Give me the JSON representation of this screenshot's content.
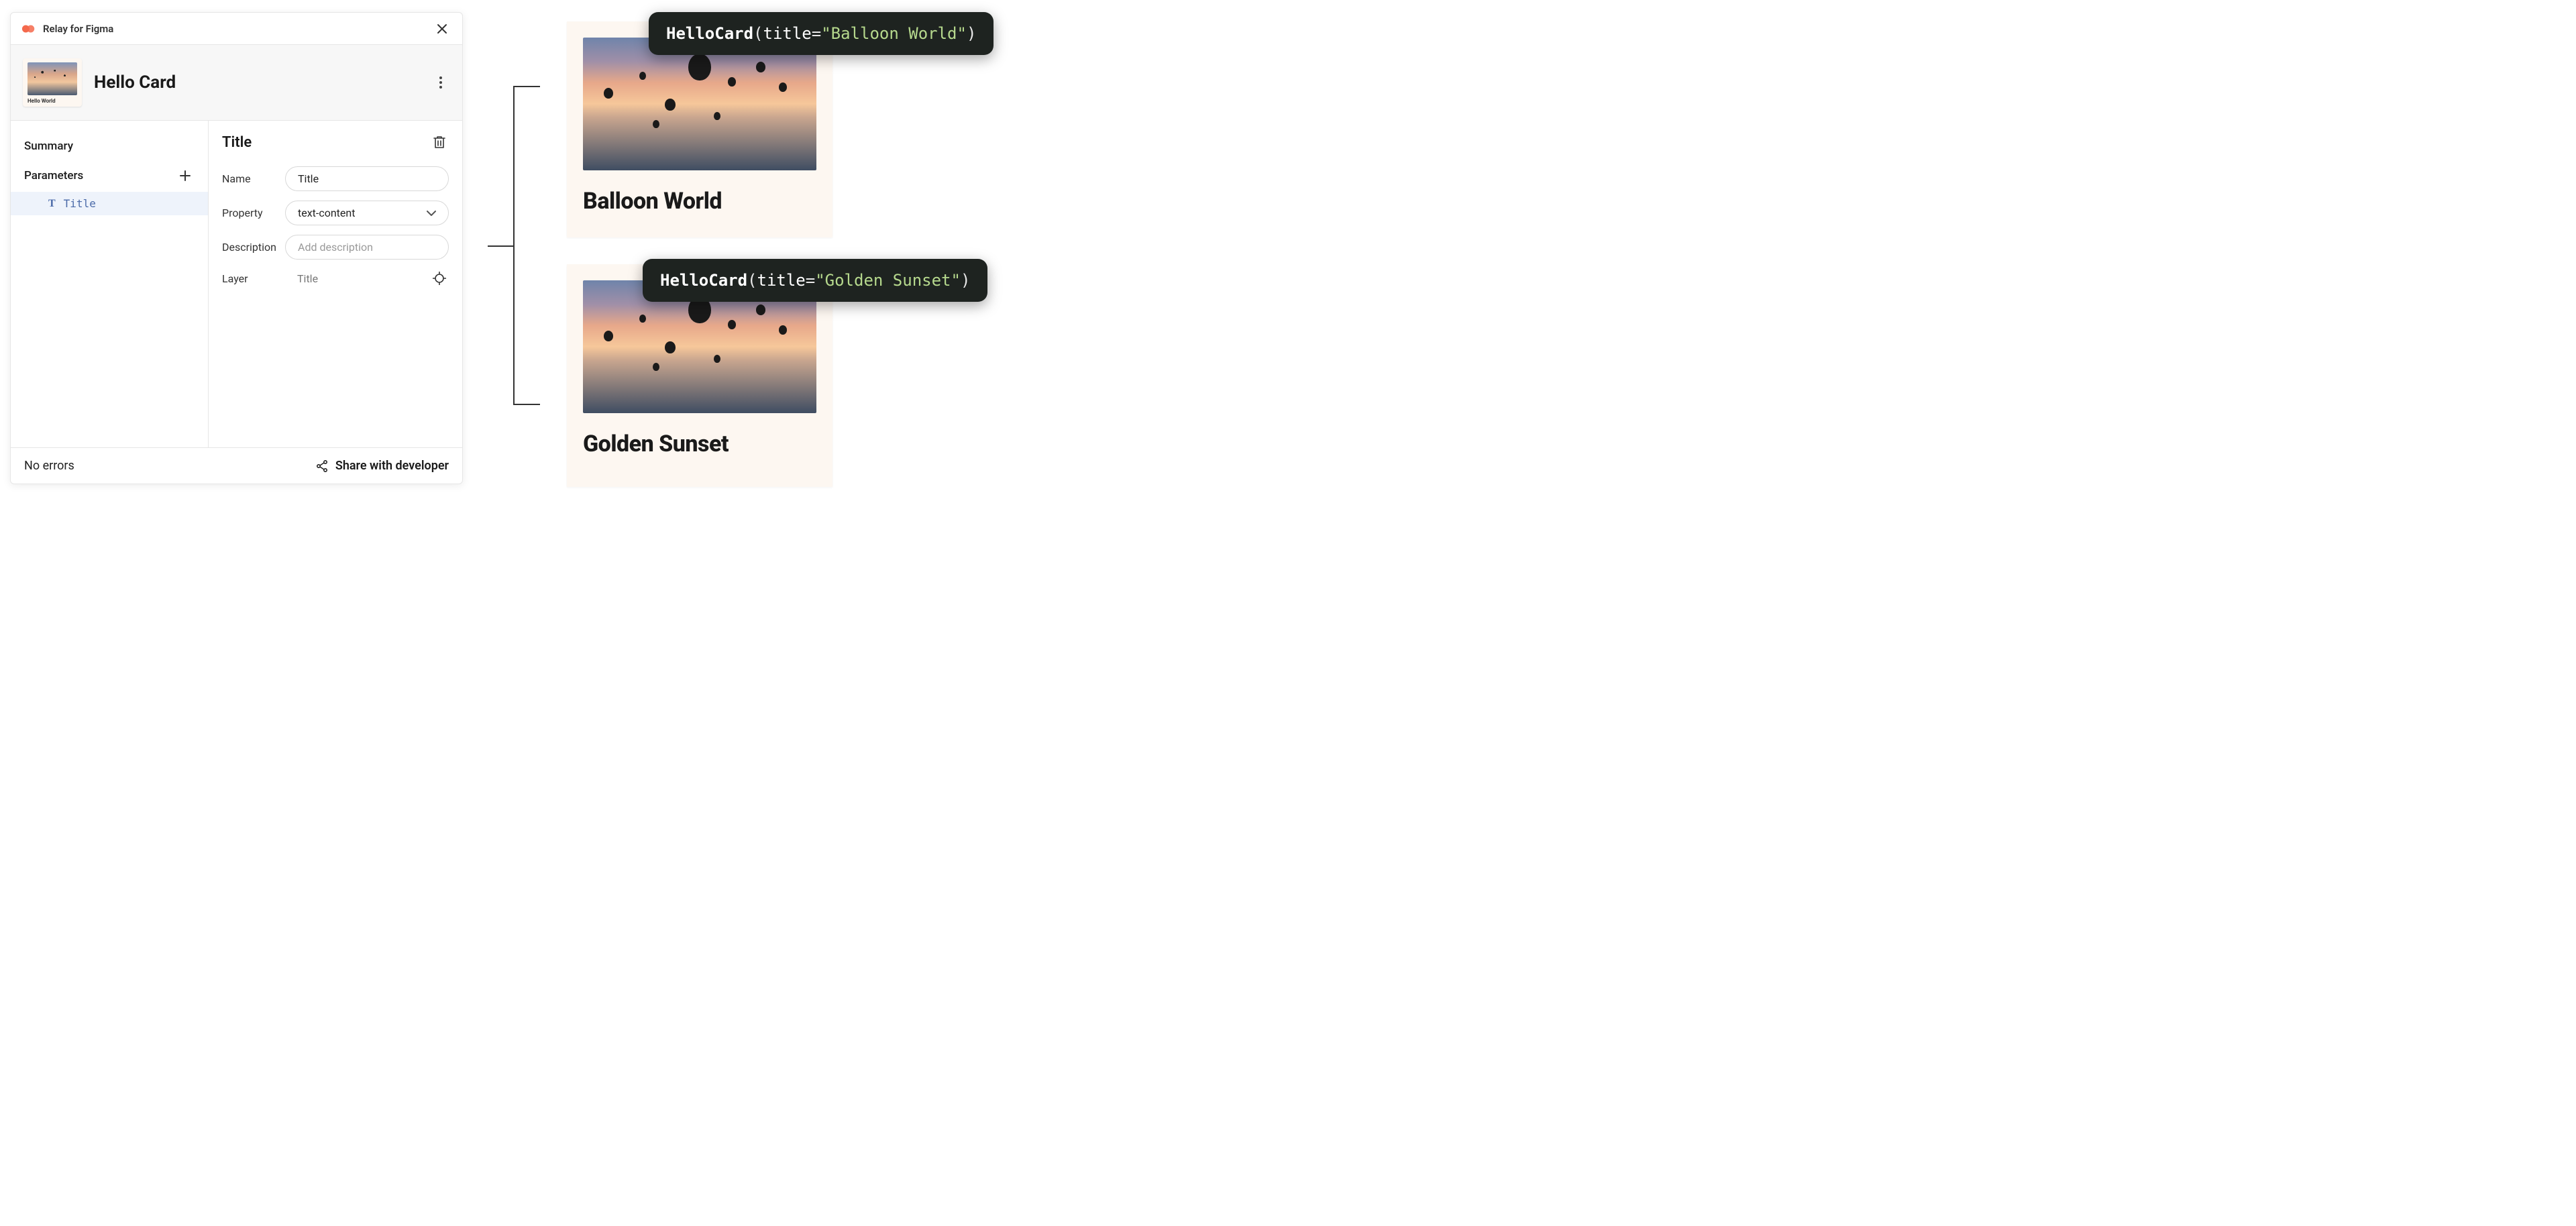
{
  "plugin": {
    "title": "Relay for Figma",
    "component_name": "Hello Card",
    "thumb_caption": "Hello World"
  },
  "sidebar": {
    "summary_label": "Summary",
    "parameters_label": "Parameters",
    "items": [
      {
        "label": "Title"
      }
    ]
  },
  "detail": {
    "heading": "Title",
    "fields": {
      "name_label": "Name",
      "name_value": "Title",
      "property_label": "Property",
      "property_value": "text-content",
      "description_label": "Description",
      "description_placeholder": "Add description",
      "layer_label": "Layer",
      "layer_value": "Title"
    }
  },
  "footer": {
    "status": "No errors",
    "share_label": "Share with developer"
  },
  "previews": {
    "card1": {
      "caption": "Balloon World",
      "code_fn": "HelloCard",
      "code_arg": "title",
      "code_str": "\"Balloon World\""
    },
    "card2": {
      "caption": "Golden Sunset",
      "code_fn": "HelloCard",
      "code_arg": "title",
      "code_str": "\"Golden Sunset\""
    }
  }
}
